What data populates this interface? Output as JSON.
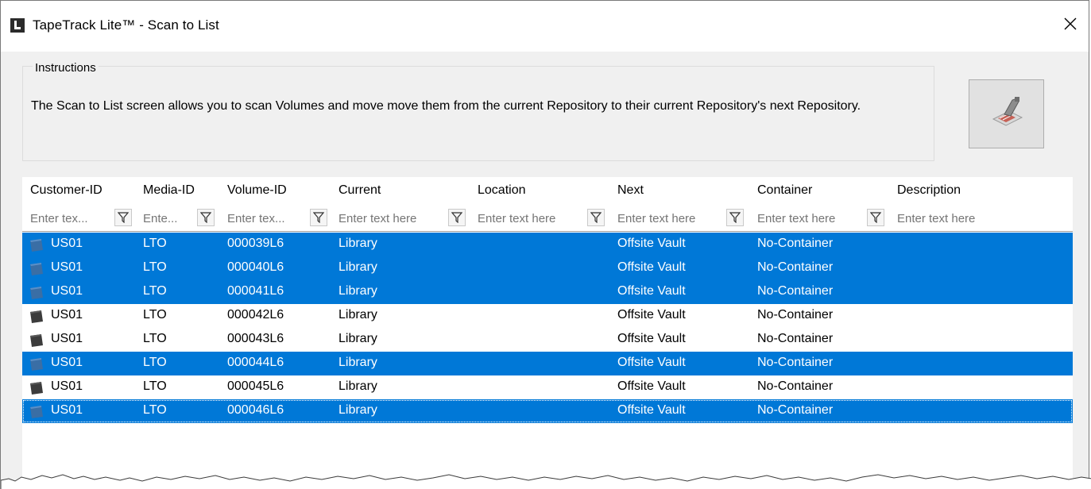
{
  "window": {
    "title": "TapeTrack Lite™ - Scan to List",
    "close_glyph": "✕"
  },
  "instructions": {
    "legend": "Instructions",
    "text": "The Scan to List screen allows you to scan Volumes and move move them from the current Repository to their current Repository's next Repository."
  },
  "scan_button": {
    "icon": "barcode-scanner-icon"
  },
  "grid": {
    "columns": [
      {
        "label": "Customer-ID",
        "placeholder": "Enter tex..."
      },
      {
        "label": "Media-ID",
        "placeholder": "Ente..."
      },
      {
        "label": "Volume-ID",
        "placeholder": "Enter tex..."
      },
      {
        "label": "Current",
        "placeholder": "Enter text here"
      },
      {
        "label": "Location",
        "placeholder": "Enter text here"
      },
      {
        "label": "Next",
        "placeholder": "Enter text here"
      },
      {
        "label": "Container",
        "placeholder": "Enter text here"
      },
      {
        "label": "Description",
        "placeholder": "Enter text here"
      }
    ],
    "rows": [
      {
        "selected": true,
        "customer": "US01",
        "media": "LTO",
        "volume": "000039L6",
        "current": "Library",
        "location": "",
        "next": "Offsite Vault",
        "container": "No-Container",
        "description": ""
      },
      {
        "selected": true,
        "customer": "US01",
        "media": "LTO",
        "volume": "000040L6",
        "current": "Library",
        "location": "",
        "next": "Offsite Vault",
        "container": "No-Container",
        "description": ""
      },
      {
        "selected": true,
        "customer": "US01",
        "media": "LTO",
        "volume": "000041L6",
        "current": "Library",
        "location": "",
        "next": "Offsite Vault",
        "container": "No-Container",
        "description": ""
      },
      {
        "selected": false,
        "customer": "US01",
        "media": "LTO",
        "volume": "000042L6",
        "current": "Library",
        "location": "",
        "next": "Offsite Vault",
        "container": "No-Container",
        "description": ""
      },
      {
        "selected": false,
        "customer": "US01",
        "media": "LTO",
        "volume": "000043L6",
        "current": "Library",
        "location": "",
        "next": "Offsite Vault",
        "container": "No-Container",
        "description": ""
      },
      {
        "selected": true,
        "customer": "US01",
        "media": "LTO",
        "volume": "000044L6",
        "current": "Library",
        "location": "",
        "next": "Offsite Vault",
        "container": "No-Container",
        "description": ""
      },
      {
        "selected": false,
        "customer": "US01",
        "media": "LTO",
        "volume": "000045L6",
        "current": "Library",
        "location": "",
        "next": "Offsite Vault",
        "container": "No-Container",
        "description": ""
      },
      {
        "selected": true,
        "customer": "US01",
        "media": "LTO",
        "volume": "000046L6",
        "current": "Library",
        "location": "",
        "next": "Offsite Vault",
        "container": "No-Container",
        "description": ""
      }
    ]
  },
  "colors": {
    "selection": "#0078d7",
    "window_bg": "#f0f0f0",
    "grid_bg": "#ffffff"
  }
}
